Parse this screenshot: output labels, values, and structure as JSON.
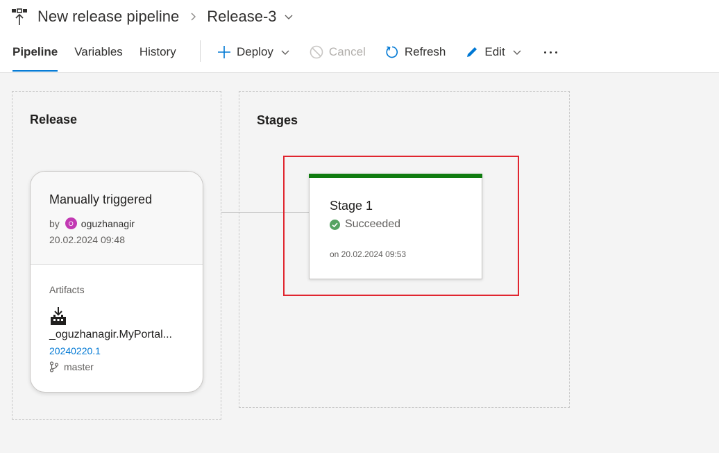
{
  "header": {
    "pipeline_name": "New release pipeline",
    "release_name": "Release-3"
  },
  "tabs": [
    {
      "label": "Pipeline",
      "active": true
    },
    {
      "label": "Variables",
      "active": false
    },
    {
      "label": "History",
      "active": false
    }
  ],
  "toolbar": {
    "deploy": "Deploy",
    "cancel": "Cancel",
    "refresh": "Refresh",
    "edit": "Edit"
  },
  "release_panel": {
    "title": "Release",
    "trigger": "Manually triggered",
    "by_label": "by",
    "avatar_initial": "O",
    "user": "oguzhanagir",
    "date": "20.02.2024 09:48",
    "artifacts_label": "Artifacts",
    "artifact_name": "_oguzhanagir.MyPortal...",
    "artifact_version": "20240220.1",
    "branch": "master"
  },
  "stages_panel": {
    "title": "Stages",
    "stage_name": "Stage 1",
    "status": "Succeeded",
    "date": "on 20.02.2024 09:53"
  },
  "colors": {
    "accent": "#0078d4",
    "success": "#107c10",
    "highlight": "#e0252f",
    "avatar": "#c239b3"
  }
}
